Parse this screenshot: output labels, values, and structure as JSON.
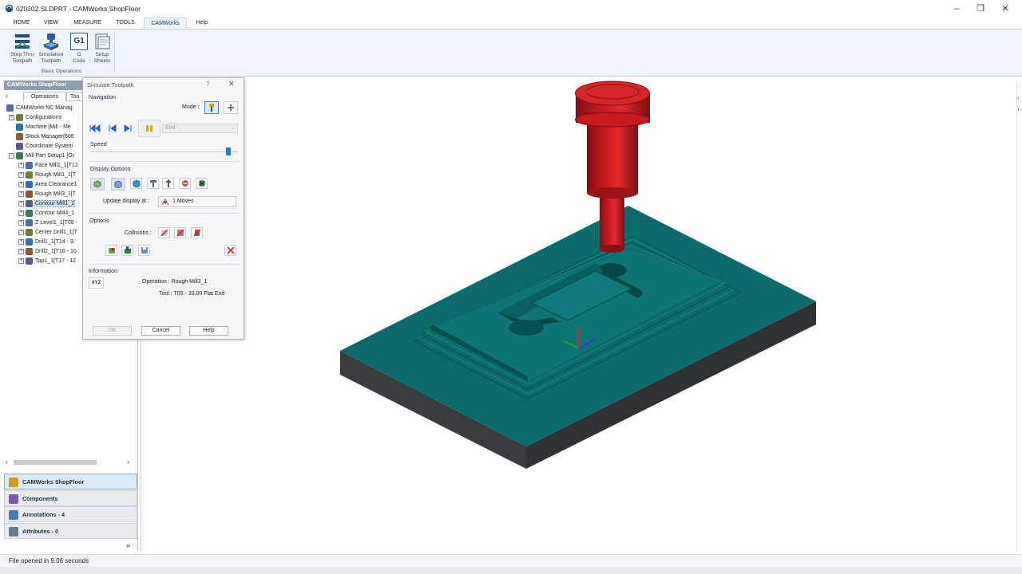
{
  "window": {
    "title": "020202.SLDPRT - CAMWorks ShopFloor",
    "minimize": "–",
    "restore": "❐",
    "close": "✕"
  },
  "ribbon_tabs": [
    "HOME",
    "VIEW",
    "MEASURE",
    "TOOLS",
    "CAMWorks",
    "Help"
  ],
  "active_tab": "CAMWorks",
  "ribbon": {
    "buttons": [
      {
        "line1": "Step Thru",
        "line2": "Toolpath"
      },
      {
        "line1": "Simulation",
        "line2": "Toolpath"
      },
      {
        "line1": "G",
        "line2": "Code"
      },
      {
        "line1": "Setup",
        "line2": "Sheets"
      }
    ],
    "g1_icon_text": "G1",
    "group_label": "Basic Operations"
  },
  "left_panel": {
    "header": "CAMWorks ShopFloor",
    "tabs": [
      "Operations",
      "Too"
    ],
    "tree": [
      {
        "label": "CAMWorks NC Manag",
        "level": 0,
        "expander": "",
        "selected": false
      },
      {
        "label": "Configurations",
        "level": 1,
        "expander": "+",
        "selected": false
      },
      {
        "label": "Machine [Mill - Me",
        "level": 1,
        "expander": "",
        "selected": false
      },
      {
        "label": "Stock Manager[606",
        "level": 1,
        "expander": "",
        "selected": false
      },
      {
        "label": "Coordinate System",
        "level": 1,
        "expander": "",
        "selected": false
      },
      {
        "label": "Mill Part Setup1 [Gr",
        "level": 1,
        "expander": "-",
        "selected": false
      },
      {
        "label": "Face Mill1_1[T12",
        "level": 2,
        "expander": "+",
        "selected": false
      },
      {
        "label": "Rough Mill1_1[T",
        "level": 2,
        "expander": "+",
        "selected": false
      },
      {
        "label": "Area Clearance1",
        "level": 2,
        "expander": "+",
        "selected": false
      },
      {
        "label": "Rough Mill3_1[T",
        "level": 2,
        "expander": "+",
        "selected": false
      },
      {
        "label": "Contour Mill1_1",
        "level": 2,
        "expander": "+",
        "selected": true
      },
      {
        "label": "Contour Mill4_1",
        "level": 2,
        "expander": "+",
        "selected": false
      },
      {
        "label": "Z Level1_1[T09 -",
        "level": 2,
        "expander": "+",
        "selected": false
      },
      {
        "label": "Center Drill1_1[T",
        "level": 2,
        "expander": "+",
        "selected": false
      },
      {
        "label": "Drill1_1[T14 - 9.",
        "level": 2,
        "expander": "+",
        "selected": false
      },
      {
        "label": "Drill2_1[T16 - 10",
        "level": 2,
        "expander": "+",
        "selected": false
      },
      {
        "label": "Tap1_1[T17 - 12",
        "level": 2,
        "expander": "+",
        "selected": false
      }
    ],
    "bottom_panels": [
      {
        "label": "CAMWorks ShopFloor",
        "selected": true
      },
      {
        "label": "Components",
        "selected": false
      },
      {
        "label": "Annotations - 4",
        "selected": false
      },
      {
        "label": "Attributes - 0",
        "selected": false
      }
    ]
  },
  "status": {
    "text": "File opened in 9.06 seconds"
  },
  "dialog": {
    "title": "Simulate Toolpath",
    "help_glyph": "?",
    "close_glyph": "✕",
    "navigation_label": "Navigation",
    "mode_label": "Mode :",
    "run_to_value": "End",
    "speed_label": "Speed",
    "speed_level": 0.93,
    "display_options_label": "Display Options",
    "update_display_label": "Update display at :",
    "update_display_value": "1 Moves",
    "options_label": "Options",
    "collisions_label": "Collisions :",
    "information_label": "Information",
    "xyz_label": "XYZ",
    "operation_text": "Operation :  Rough Mill3_1",
    "tool_text": "Tool :  T05 - 20.00 Flat End",
    "ok_label": "OK",
    "cancel_label": "Cancel",
    "help_label": "Help"
  },
  "colors": {
    "part_top": "#0b6b6a",
    "part_side_dark": "#3a3d3f",
    "tool_red": "#c0181c",
    "ribbon_bg": "#eef3f9",
    "selection": "#cce4f7"
  }
}
